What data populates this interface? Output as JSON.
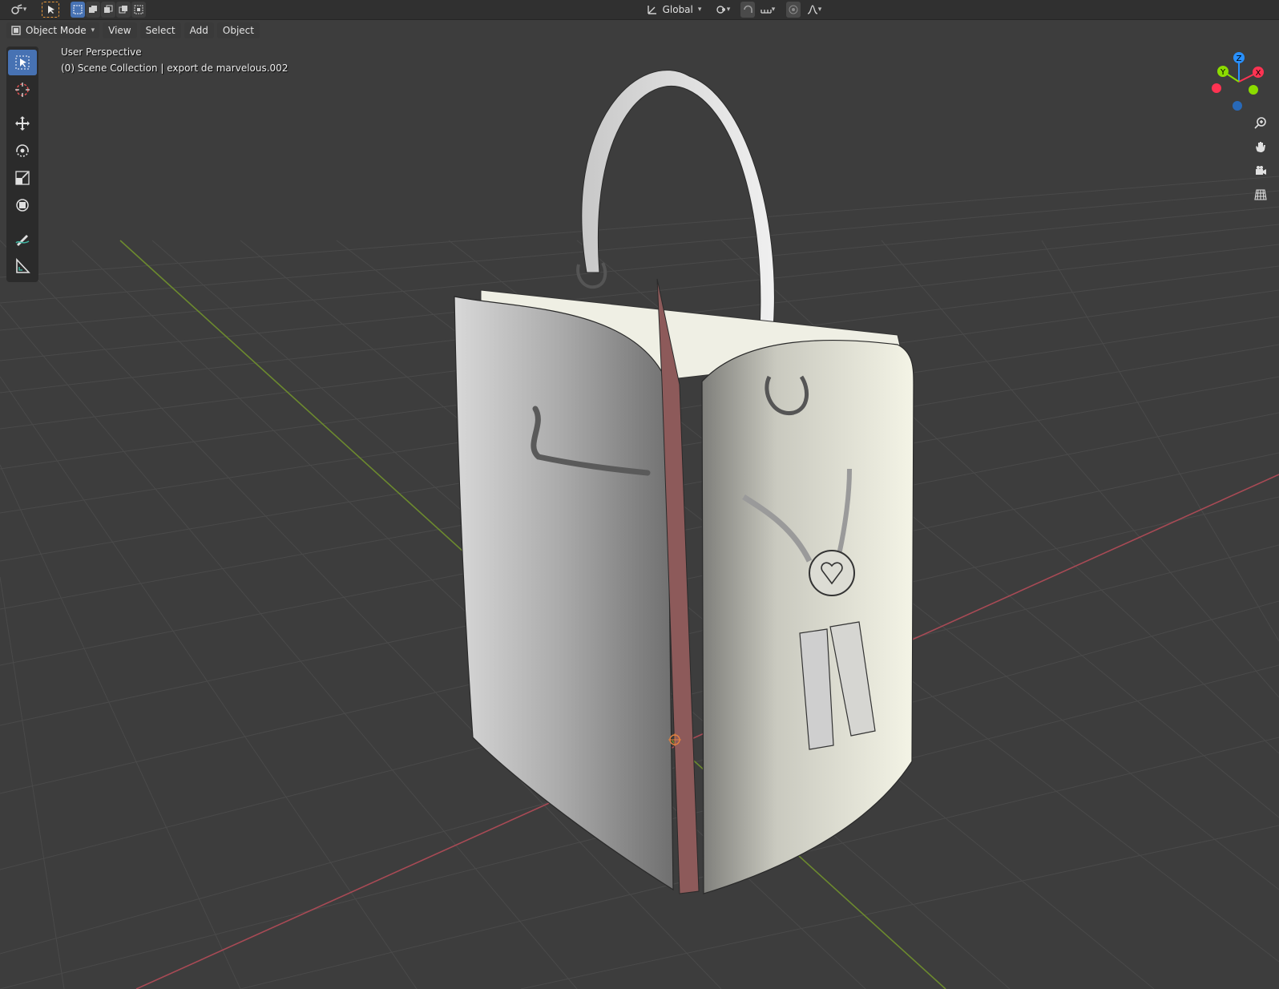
{
  "header": {
    "editor_type_icon": "3d-viewport-icon",
    "transform_orientation": "Global",
    "icons": [
      "select-box-icon",
      "selection-mode-new-icon",
      "selection-mode-extend-icon",
      "selection-mode-subtract-icon",
      "selection-mode-invert-icon",
      "selection-mode-intersect-icon",
      "pivot-point-icon",
      "snap-icon",
      "snap-increment-icon",
      "proportional-editing-icon",
      "proportional-falloff-icon"
    ]
  },
  "menubar": {
    "mode": "Object Mode",
    "items": [
      "View",
      "Select",
      "Add",
      "Object"
    ]
  },
  "viewport": {
    "view_name": "User Perspective",
    "collection_info": "(0) Scene Collection | export de marvelous.002",
    "gizmo_axes": [
      "Z",
      "Y",
      "X"
    ],
    "axis_colors": {
      "x": "#ff3352",
      "y": "#8bdc00",
      "z": "#2890ff"
    },
    "nav_icons": [
      "zoom-icon",
      "hand-pan-icon",
      "camera-icon",
      "grid-ortho-icon"
    ]
  },
  "toolbar": {
    "tools": [
      "select-box-icon",
      "cursor-icon",
      "move-icon",
      "rotate-icon",
      "scale-icon",
      "transform-icon",
      "annotate-icon",
      "measure-icon"
    ]
  },
  "colors": {
    "background": "#3d3d3d",
    "header": "#303030",
    "active": "#4772b3",
    "grid_line": "#4a4a4a"
  }
}
